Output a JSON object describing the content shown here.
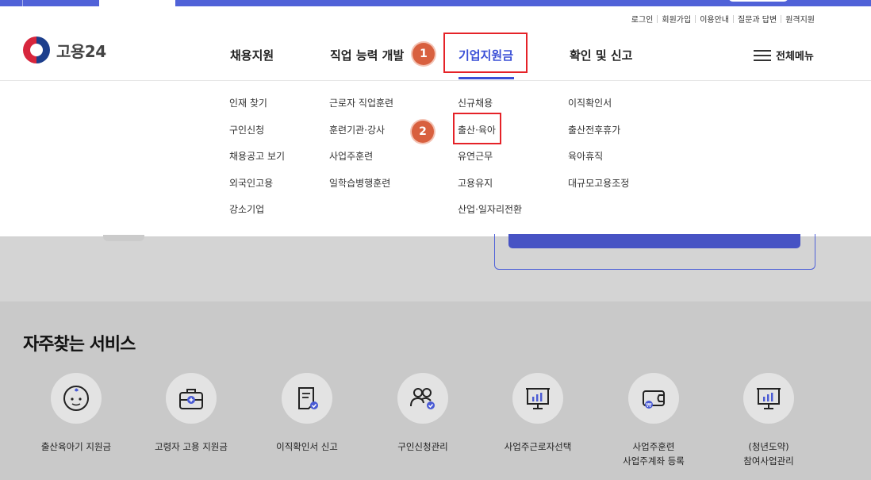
{
  "utility_nav": [
    "로그인",
    "회원가입",
    "이용안내",
    "질문과 답변",
    "원격지원"
  ],
  "logo": {
    "text": "고용24"
  },
  "gnb": {
    "items": [
      "채용지원",
      "직업 능력 개발",
      "기업지원금",
      "확인 및 신고"
    ],
    "active": "기업지원금",
    "all_menu": "전체메뉴"
  },
  "badges": {
    "first": "1",
    "second": "2"
  },
  "dropdown": {
    "col1": [
      "인재 찾기",
      "구인신청",
      "채용공고 보기",
      "외국인고용",
      "강소기업"
    ],
    "col2": [
      "근로자 직업훈련",
      "훈련기관·강사",
      "사업주훈련",
      "일학습병행훈련"
    ],
    "col3": [
      "신규채용",
      "출산·육아",
      "유연근무",
      "고용유지",
      "산업·일자리전환"
    ],
    "col4": [
      "이직확인서",
      "출산전후휴가",
      "육아휴직",
      "대규모고용조정"
    ]
  },
  "services": {
    "title": "자주찾는 서비스",
    "items": [
      {
        "label": "출산육아기 지원금",
        "icon": "baby-icon"
      },
      {
        "label": "고령자 고용 지원금",
        "icon": "first-aid-kit-icon"
      },
      {
        "label": "이직확인서 신고",
        "icon": "document-check-icon"
      },
      {
        "label": "구인신청관리",
        "icon": "people-check-icon"
      },
      {
        "label": "사업주근로자선택",
        "icon": "presentation-chart-icon"
      },
      {
        "label": "사업주훈련\n사업주계좌 등록",
        "icon": "wallet-icon"
      },
      {
        "label": "(청년도약)\n참여사업관리",
        "icon": "presentation-chart-icon"
      }
    ]
  },
  "colors": {
    "accent": "#3a4fd6",
    "highlight": "#e52228",
    "badge": "#d8603f"
  }
}
